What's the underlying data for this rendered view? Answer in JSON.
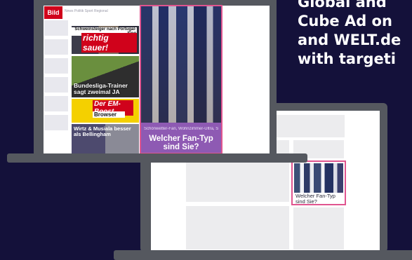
{
  "headline": {
    "lines": [
      "Global and",
      "Cube Ad on",
      "and WELT.de",
      "with targeti"
    ]
  },
  "site": {
    "logo_text": "Bild",
    "nav_text": "News  Politik  Sport  Regional"
  },
  "news": {
    "tile1": {
      "kicker": "Schweinsteiger nach Portugal-Sieg",
      "headline": "richtig sauer!"
    },
    "tile2": {
      "headline": "Bundesliga-Trainer sagt zweimal JA"
    },
    "tile3": {
      "headline": "Der EM-Boost",
      "sub": "Browser"
    },
    "tile4": {
      "headline": "Wirtz & Musiala besser als Bellingham"
    }
  },
  "ad": {
    "tagline": "Schönwetter-Fan, Wohnzimmer-Ultra, Selfie-Jäger",
    "title": "Welcher Fan-Typ sind Sie?"
  },
  "cube_ad": {
    "caption": "Welcher Fan-Typ sind Sie?"
  },
  "colors": {
    "background": "#14113a",
    "laptop_frame": "#55585f",
    "ad_border": "#e0558f",
    "ad_panel": "#8e5ab3",
    "brand_red": "#d0021b"
  }
}
